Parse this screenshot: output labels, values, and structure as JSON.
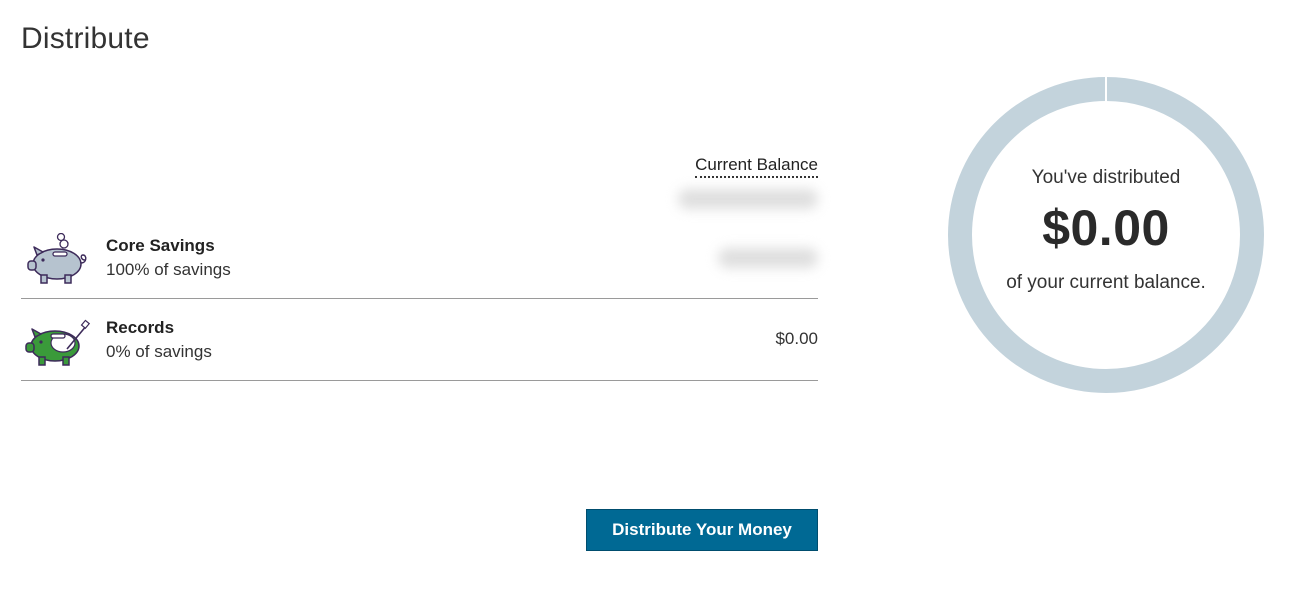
{
  "page": {
    "title": "Distribute"
  },
  "balance": {
    "header_label": "Current Balance"
  },
  "accounts": [
    {
      "icon": "piggy-bank-icon",
      "name": "Core Savings",
      "percent_label": "100% of savings",
      "amount": ""
    },
    {
      "icon": "piggy-bank-records-icon",
      "name": "Records",
      "percent_label": "0% of savings",
      "amount": "$0.00"
    }
  ],
  "actions": {
    "distribute_label": "Distribute Your Money"
  },
  "summary": {
    "line1": "You've distributed",
    "amount": "$0.00",
    "line2": "of your current balance.",
    "distributed_fraction": 0
  },
  "colors": {
    "button": "#006994",
    "ring": "#c3d3dc",
    "accent_green": "#3a9a3a",
    "icon_gray": "#b6c3cf"
  }
}
